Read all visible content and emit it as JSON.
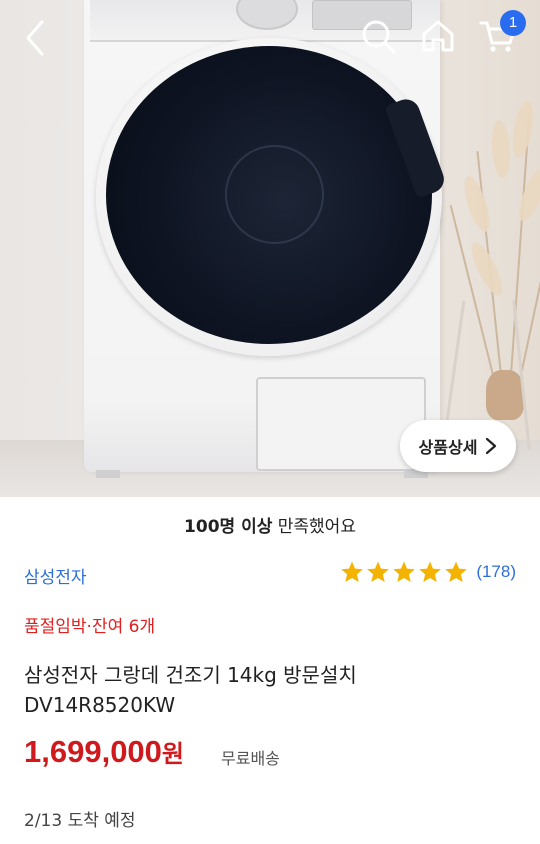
{
  "header": {
    "cart_count": "1"
  },
  "hero": {
    "detail_button_label": "상품상세"
  },
  "summary": {
    "satisfaction_bold": "100명 이상",
    "satisfaction_rest": " 만족했어요"
  },
  "product": {
    "brand": "삼성전자",
    "rating_stars": 5,
    "review_count": "(178)",
    "stock_notice": "품절임박·잔여 6개",
    "title_line1": "삼성전자 그랑데 건조기 14kg 방문설치",
    "title_line2": "DV14R8520KW",
    "price_amount": "1,699,000",
    "price_unit": "원",
    "shipping": "무료배송",
    "arrival": "2/13 도착 예정"
  },
  "colors": {
    "accent_blue": "#2d6fd8",
    "badge_blue": "#2a6cf0",
    "price_red": "#d0191c",
    "stock_red": "#e02020",
    "star_yellow": "#f5b301"
  }
}
